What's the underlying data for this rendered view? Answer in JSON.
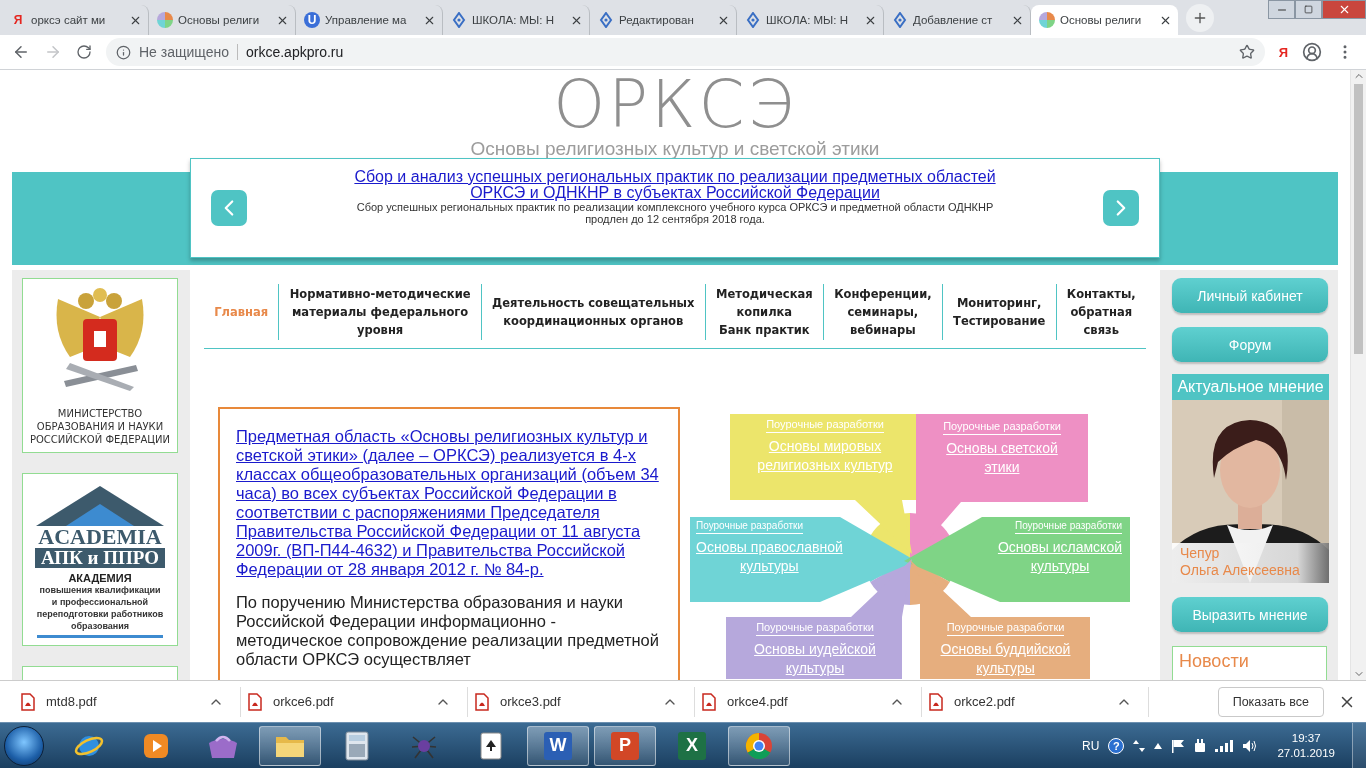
{
  "browser": {
    "tabs": [
      {
        "title": "орксэ сайт ми",
        "kind": "letter",
        "glyph": "Я",
        "selected": false
      },
      {
        "title": "Основы религи",
        "kind": "pinwheel",
        "selected": false
      },
      {
        "title": "Управление ма",
        "kind": "badge",
        "glyph": "U",
        "selected": false
      },
      {
        "title": "ШКОЛА: МЫ: Н",
        "kind": "drop",
        "selected": false
      },
      {
        "title": "Редактирован",
        "kind": "drop",
        "selected": false
      },
      {
        "title": "ШКОЛА: МЫ: Н",
        "kind": "drop",
        "selected": false
      },
      {
        "title": "Добавление ст",
        "kind": "drop",
        "selected": false
      },
      {
        "title": "Основы религи",
        "kind": "pinwheel",
        "selected": true
      }
    ],
    "forward_enabled": false,
    "security": "Не защищено",
    "url": "orkce.apkpro.ru",
    "extension_glyph": "Я"
  },
  "site": {
    "logo": "ОРКСЭ",
    "tagline": "Основы религиозных культур и светской этики",
    "slider": {
      "title_lines": [
        "Сбор и анализ успешных региональных практик по реализации предметных областей",
        "ОРКСЭ и ОДНКНР в субъектах Российской Федерации"
      ],
      "summary_lines": [
        "Сбор успешных региональных практик по реализации комплексного учебного курса ОРКСЭ и предметной области ОДНКНР",
        "продлен до 12 сентября 2018 года."
      ]
    },
    "nav": [
      {
        "lines": [
          "Главная"
        ],
        "selected": true
      },
      {
        "lines": [
          "Нормативно-методические",
          "материалы федерального",
          "уровня"
        ],
        "selected": false
      },
      {
        "lines": [
          "Деятельность совещательных",
          "координационных органов"
        ],
        "selected": false
      },
      {
        "lines": [
          "Методическая",
          "копилка",
          "Банк практик"
        ],
        "selected": false
      },
      {
        "lines": [
          "Конференции,",
          "семинары,",
          "вебинары"
        ],
        "selected": false
      },
      {
        "lines": [
          "Мониторинг,",
          "Тестирование"
        ],
        "selected": false
      },
      {
        "lines": [
          "Контакты,",
          "обратная",
          "связь"
        ],
        "selected": false
      }
    ],
    "left": {
      "ministry_lines": [
        "МИНИСТЕРСТВО",
        "ОБРАЗОВАНИЯ И НАУКИ",
        "РОССИЙСКОЙ ФЕДЕРАЦИИ"
      ],
      "academy": {
        "brand": "ACADEMIA",
        "bar": "АПК и ППРО",
        "title": "АКАДЕМИЯ",
        "lines": [
          "повышения квалификации",
          "и профессиональной",
          "переподготовки работников",
          "образования"
        ]
      }
    },
    "intro": {
      "link": "Предметная область «Основы религиозных культур и светской этики» (далее – ОРКСЭ) реализуется в 4-х классах общеобразовательных организаций (объем 34 часа) во всех субъектах Российской Федерации в соответствии с распоряжениями Председателя Правительства Российской Федерации от 11 августа 2009г. (ВП-П44-4632) и Правительства Российской Федерации от 28 января 2012 г. № 84-р.",
      "text": "По поручению Министерства образования и науки Российской Федерации информационно - методическое сопровождение реализации предметной области ОРКСЭ осуществляет"
    },
    "diagram": {
      "modules": [
        {
          "kind": "top-left",
          "color": "#ece56b",
          "label": "Поурочные разработки",
          "title_lines": [
            "Основы мировых",
            "религиозных культур"
          ]
        },
        {
          "kind": "top-right",
          "color": "#ee90c4",
          "label": "Поурочные разработки",
          "title_lines": [
            "Основы светской",
            "этики"
          ]
        },
        {
          "kind": "left",
          "color": "#6fd4d6",
          "label": "Поурочные разработки",
          "title_lines": [
            "Основы православной",
            "культуры"
          ]
        },
        {
          "kind": "right",
          "color": "#7fd486",
          "label": "Поурочные разработки",
          "title_lines": [
            "Основы исламской",
            "культуры"
          ]
        },
        {
          "kind": "bottom-left",
          "color": "#b6a8dc",
          "label": "Поурочные разработки",
          "title_lines": [
            "Основы иудейской",
            "культуры"
          ]
        },
        {
          "kind": "bottom-right",
          "color": "#e6ae7e",
          "label": "Поурочные разработки",
          "title_lines": [
            "Основы буддийской",
            "культуры"
          ]
        }
      ]
    },
    "right": {
      "account": "Личный кабинет",
      "forum": "Форум",
      "opinion": {
        "title": "Актуальное мнение",
        "name_lines": [
          "Чепур",
          "Ольга Алексеевна"
        ]
      },
      "opine": "Выразить мнение",
      "news": "Новости"
    }
  },
  "downloads": {
    "files": [
      "mtd8.pdf",
      "orkce6.pdf",
      "orkce3.pdf",
      "orkce4.pdf",
      "orkce2.pdf"
    ],
    "show_all": "Показать все"
  },
  "taskbar": {
    "apps": [
      {
        "kind": "ie",
        "open": false
      },
      {
        "kind": "media",
        "open": false
      },
      {
        "kind": "bag",
        "open": false
      },
      {
        "kind": "folder",
        "open": true
      },
      {
        "kind": "calculator",
        "open": false
      },
      {
        "kind": "spider",
        "open": false
      },
      {
        "kind": "cards",
        "open": false
      },
      {
        "kind": "tile",
        "glyph": "W",
        "color": "#2b5fb4",
        "open": true
      },
      {
        "kind": "tile",
        "glyph": "P",
        "color": "#d24726",
        "open": true
      },
      {
        "kind": "tile",
        "glyph": "X",
        "color": "#1e7145",
        "open": false
      },
      {
        "kind": "chrome",
        "open": true
      }
    ],
    "lang": "RU",
    "help_glyph": "?",
    "time": "19:37",
    "date": "27.01.2019"
  }
}
